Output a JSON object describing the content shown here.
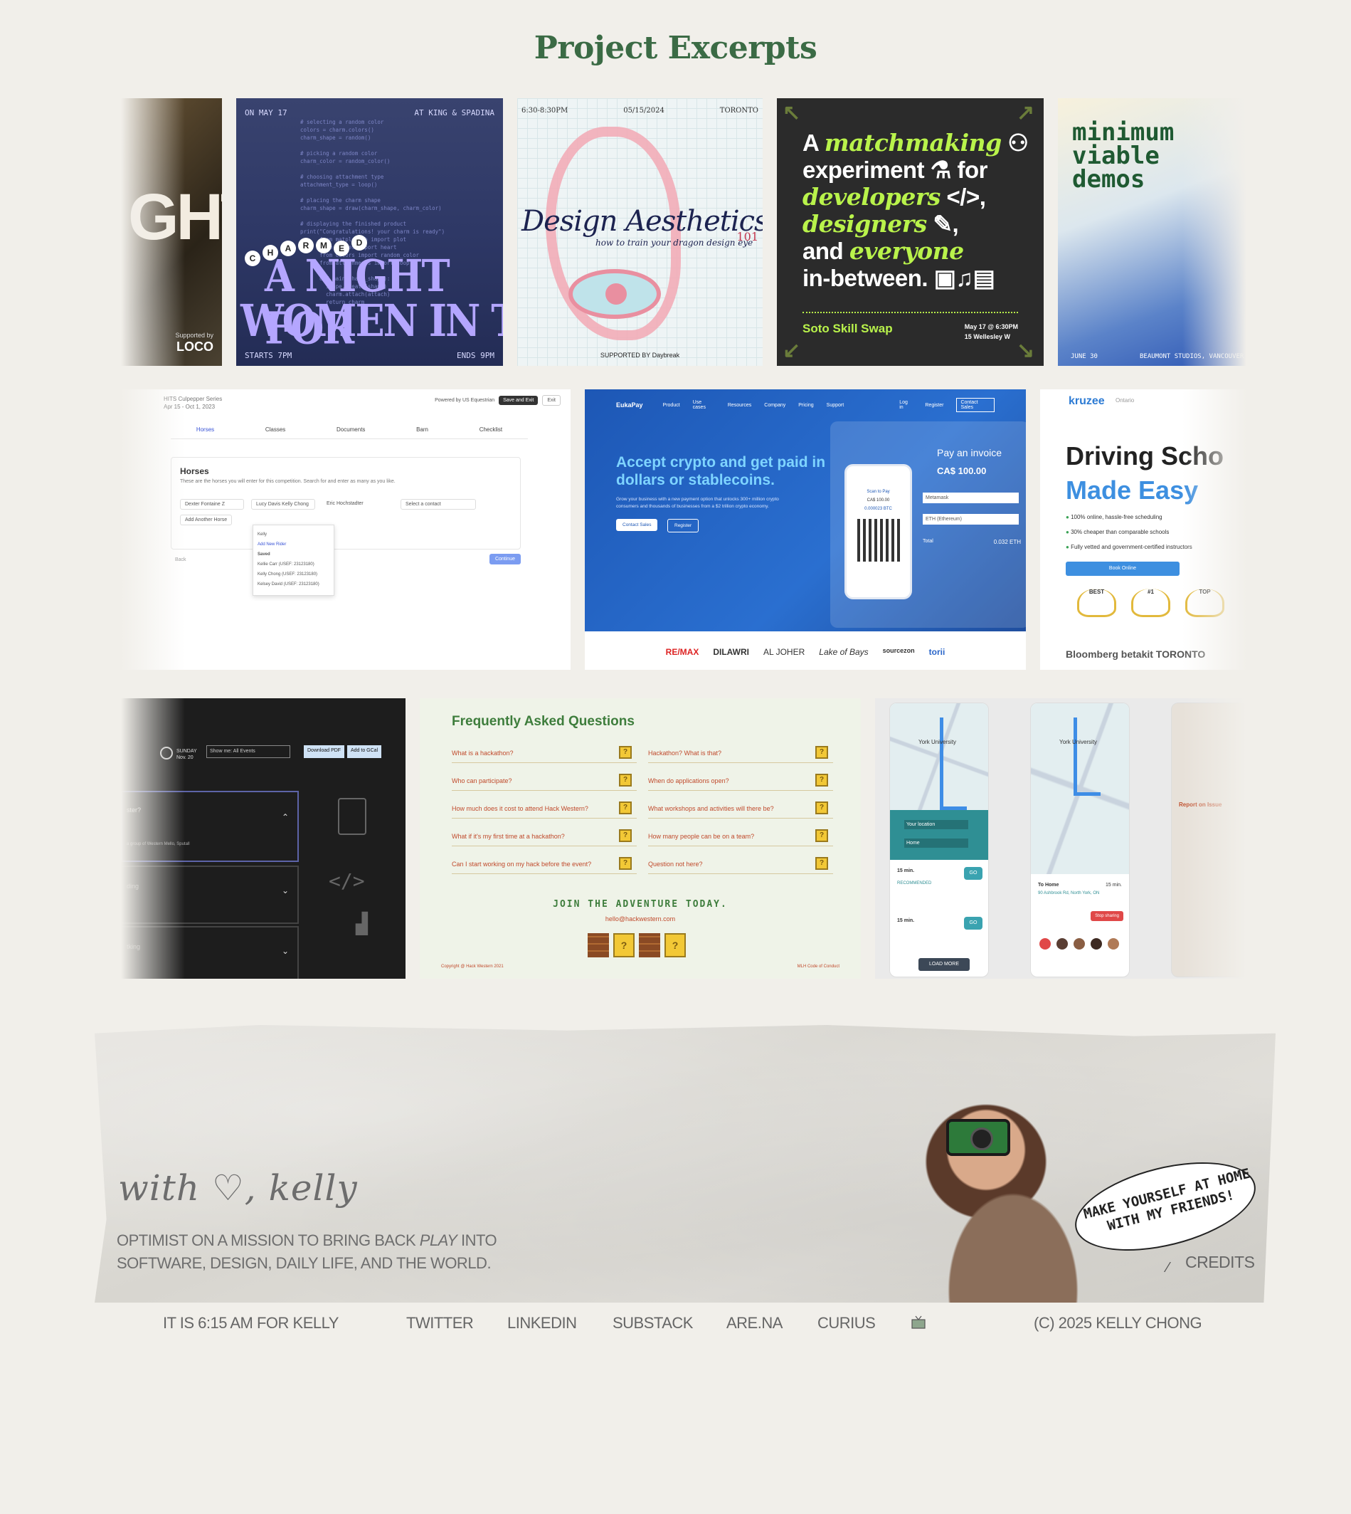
{
  "page": {
    "title": "Project Excerpts"
  },
  "projects": {
    "night": {
      "big": "GHT",
      "supported_by": "Supported by",
      "logo": "LOCO"
    },
    "wit": {
      "date": "ON MAY 17",
      "location": "AT KING & SPADINA",
      "charmed": [
        "C",
        "H",
        "A",
        "R",
        "M",
        "E",
        "D"
      ],
      "title_line1": "A NIGHT FOR",
      "title_line2": "WOMEN IN TECH",
      "starts": "STARTS 7PM",
      "ends": "ENDS 9PM",
      "code": "# selecting a random color\ncolors = charm.colors()\ncharm_shape = random()\n\n# picking a random color\ncharm_color = random_color()\n\n# choosing attachment type\nattachment_type = loop()\n\n# placing the charm shape\ncharm_shape = draw(charm_shape, charm_color)\n\n# displaying the finished product\nprint(\"Congratulations! your charm is ready\")\n      from matplotlib import plot\n      from shapes import heart\n      from colors import random_color\n      from attachments import loop\n\n      def main(charm_shape):\n        shape.create(shape)\n        charm.attach(attach)\n        return charm"
    },
    "design": {
      "time": "6:30-8:30PM",
      "date": "05/15/2024",
      "city": "TORONTO",
      "title": "Design Aesthetics",
      "number": "101",
      "subtitle": "how to train your dragon design eye",
      "supported": "SUPPORTED BY Daybreak"
    },
    "skill": {
      "line1": "A ",
      "matchmaking": "matchmaking",
      "line2": "experiment",
      "for": " for",
      "developers": "developers",
      "designers": "designers",
      "and": "and ",
      "everyone": "everyone",
      "inbetween": "in-between.",
      "name": "Soto Skill Swap",
      "when": "May 17 @ 6:30PM",
      "where": "15 Wellesley W"
    },
    "mvd": {
      "title": [
        "minimum",
        "viable",
        "demos"
      ],
      "date": "JUNE 30",
      "place": "BEAUMONT STUDIOS, VANCOUVER"
    },
    "form": {
      "series": "HITS Culpepper Series",
      "dates": "Apr 15 - Oct 1, 2023",
      "powered": "Powered by US Equestrian",
      "save_exit": "Save and Exit",
      "exit": "Exit",
      "tabs": [
        "Horses",
        "Classes",
        "Documents",
        "Barn",
        "Checklist"
      ],
      "heading": "Horses",
      "desc": "These are the horses you will enter for this competition. Search for and enter as many as you like.",
      "horse": "Dexter Fontaine Z",
      "rider": "Lucy Davis  Kelly Chong",
      "owner": "Eric Hochstadter",
      "contact": "Select a contact",
      "add_horse": "Add Another Horse",
      "search": "Kelly",
      "add_rider": "Add New Rider",
      "saved": "Saved",
      "riders": [
        "Kellie Carr (USEF: 23123180)",
        "Kelly Chong (USEF: 23123180)",
        "Kelsey David (USEF: 23123180)"
      ],
      "back": "Back",
      "continue": "Continue"
    },
    "euka": {
      "logo": "EukaPay",
      "nav": [
        "Product",
        "Use cases",
        "Resources",
        "Company",
        "Pricing",
        "Support",
        "Log in",
        "Register",
        "Contact Sales"
      ],
      "headline_accent": "Accept crypto",
      "headline_rest": " and get paid in dollars or stablecoins.",
      "body": "Grow your business with a new payment option that unlocks 300+ million crypto consumers and thousands of businesses from a $2 trillion crypto economy.",
      "cta1": "Contact Sales",
      "cta2": "Register",
      "pay_invoice": "Pay an invoice",
      "amount": "CA$ 100.00",
      "scan": "Scan to Pay",
      "phone_amount": "CA$ 100.00",
      "btc": "0.000023 BTC",
      "wallet": "Metamask",
      "currency": "ETH (Ethereum)",
      "total_label": "Total",
      "total": "0.032 ETH",
      "logos": [
        "RE/MAX",
        "DILAWRI",
        "AL JOHER",
        "Lake of Bays",
        "sourcezon",
        "torii"
      ]
    },
    "kruzee": {
      "logo": "kruzee",
      "province": "Ontario",
      "headline1": "Driving Scho",
      "headline2_a": "Made ",
      "headline2_b": "Easy",
      "bullets": [
        "100% online, hassle-free scheduling",
        "30% cheaper than comparable schools",
        "Fully vetted and government-certified instructors"
      ],
      "book": "Book Online",
      "awards": [
        "BEST",
        "#1",
        "TOP"
      ],
      "press": "Bloomberg  betakit  TORONTO"
    },
    "dark": {
      "day": "SUNDAY",
      "date": "Nov. 20",
      "filter": "Show me: All Events",
      "download": "Download PDF",
      "gcal": "Add to GCal",
      "q1": "ster?",
      "a1": "a group of Western Mello, Sputall",
      "q2": "ding",
      "q3": "tking"
    },
    "faq": {
      "title": "Frequently Asked Questions",
      "left": [
        "What is a hackathon?",
        "Who can participate?",
        "How much does it cost to attend Hack Western?",
        "What if it's my first time at a hackathon?",
        "Can I start working on my hack before the event?"
      ],
      "right": [
        "Hackathon? What is that?",
        "When do applications open?",
        "What workshops and activities will there be?",
        "How many people can be on a team?",
        "Question not here?"
      ],
      "join": "JOIN THE ADVENTURE TODAY.",
      "email": "hello@hackwestern.com",
      "copyright": "Copyright @ Hack Western 2021",
      "mlh": "MLH Code of Conduct"
    },
    "maps": {
      "campus": "York University",
      "your_location": "Your location",
      "home": "Home",
      "eta": "15 min.",
      "recommended": "RECOMMENDED",
      "go": "GO",
      "load_more": "LOAD MORE",
      "to_home": "To Home",
      "address": "90 Ashbrook Rd, North York, ON",
      "stop_sharing": "Stop sharing",
      "report": "Report on Issue"
    }
  },
  "footer": {
    "signature": "with ♡, kelly",
    "bio_1": "OPTIMIST ON A MISSION TO BRING BACK ",
    "bio_play": "PLAY",
    "bio_2": "  INTO SOFTWARE, DESIGN, DAILY LIFE, AND THE WORLD.",
    "bubble": "MAKE YOURSELF AT HOME WITH MY FRIENDS!",
    "credits": "CREDITS",
    "time": "IT IS 6:15 AM FOR KELLY",
    "links": [
      "TWITTER",
      "LINKEDIN",
      "SUBSTACK",
      "ARE.NA",
      "CURIUS"
    ],
    "copyright": "(C) 2025 KELLY CHONG"
  },
  "colors": {
    "background": "#f1efea",
    "title_green": "#3b6b45",
    "footer_text": "#666666"
  }
}
